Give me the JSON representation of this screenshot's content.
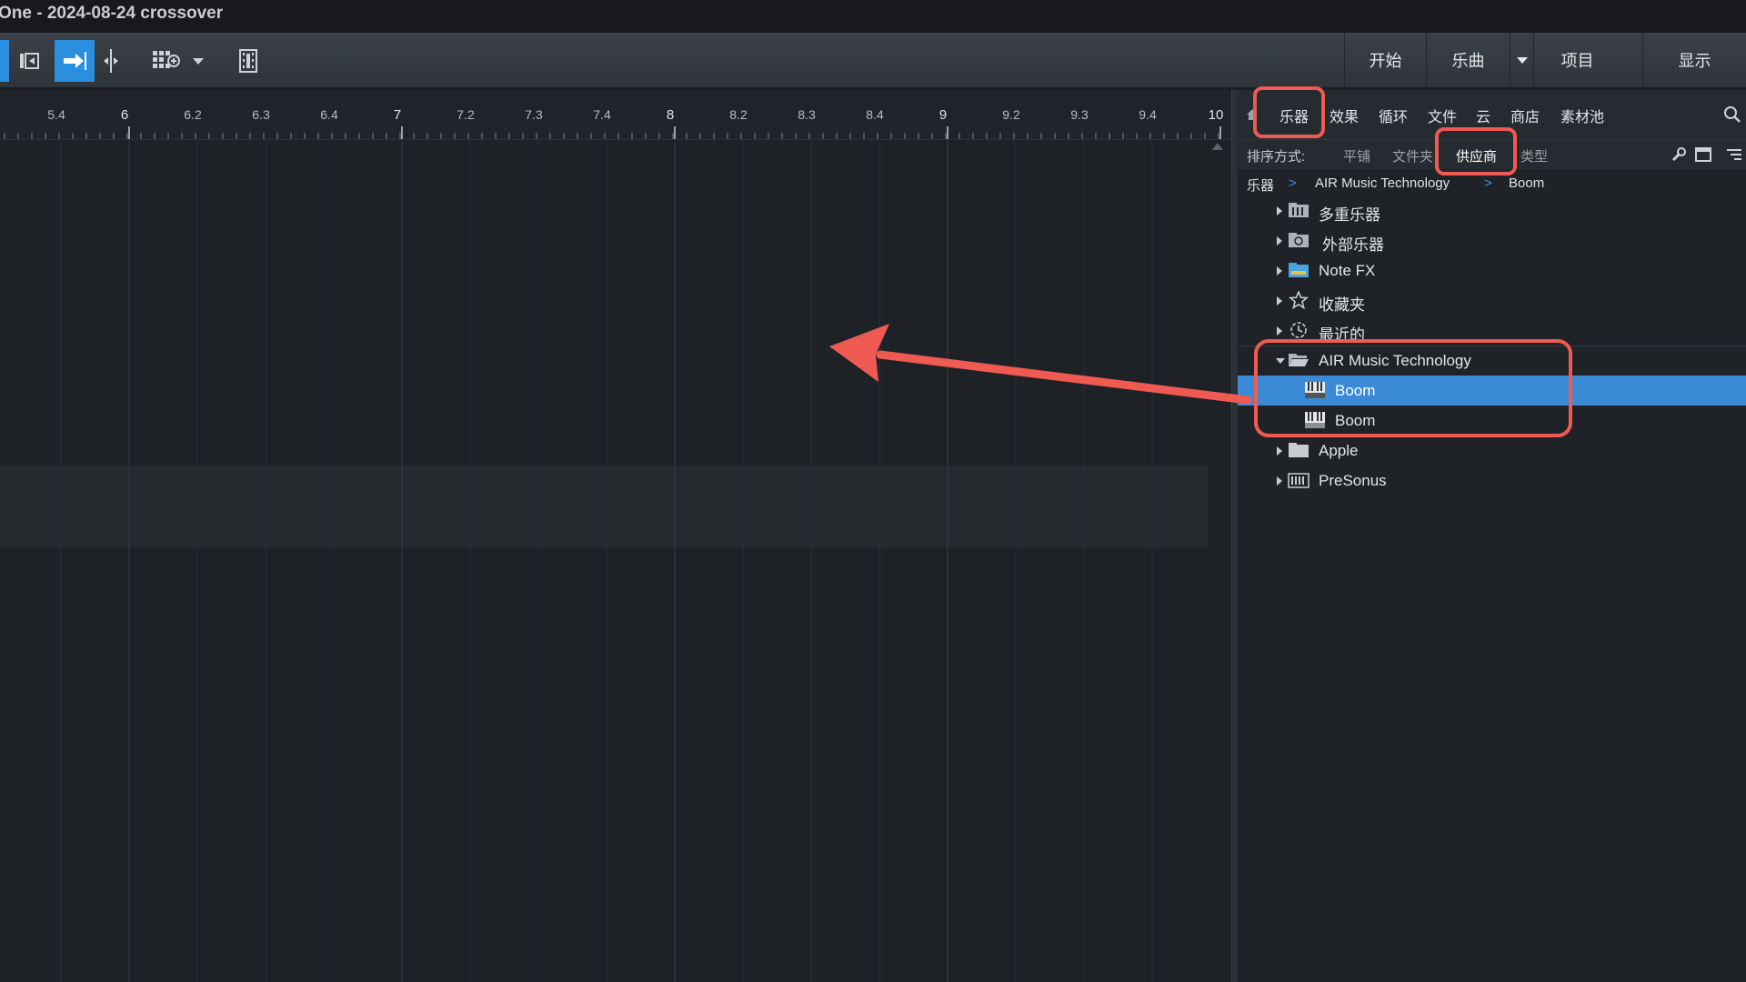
{
  "window": {
    "title": "One - 2024-08-24 crossover"
  },
  "toolbar": {
    "left_tools": [
      "track-zoom-icon",
      "follow-arrow-icon",
      "split-cursor-icon",
      "grid-add-icon",
      "dropdown-caret-icon",
      "film-strip-icon"
    ],
    "right_tabs": [
      {
        "label": "开始"
      },
      {
        "label": "乐曲"
      },
      {
        "label": "项目"
      },
      {
        "label": "显示"
      }
    ]
  },
  "ruler": {
    "labels": [
      "5.4",
      "6",
      "6.2",
      "6.3",
      "6.4",
      "7",
      "7.2",
      "7.3",
      "7.4",
      "8",
      "8.2",
      "8.3",
      "8.4",
      "9",
      "9.2",
      "9.3",
      "9.4",
      "10"
    ],
    "major": [
      "6",
      "7",
      "8",
      "9",
      "10"
    ]
  },
  "browser": {
    "tabs": [
      "乐器",
      "效果",
      "循环",
      "文件",
      "云",
      "商店",
      "素材池"
    ],
    "active_tab": "乐器",
    "sort": {
      "label": "排序方式:",
      "options": [
        "平铺",
        "文件夹",
        "供应商",
        "类型"
      ],
      "active": "供应商"
    },
    "breadcrumb": [
      "乐器",
      "AIR Music Technology",
      "Boom"
    ],
    "breadcrumb_sep": ">",
    "tree": [
      {
        "label": "多重乐器",
        "icon": "multi-instrument-folder-icon",
        "state": "closed"
      },
      {
        "label": "外部乐器",
        "icon": "external-instrument-folder-icon",
        "state": "closed"
      },
      {
        "label": "Note FX",
        "icon": "note-fx-folder-icon",
        "state": "closed"
      },
      {
        "label": "收藏夹",
        "icon": "star-icon",
        "state": "closed"
      },
      {
        "label": "最近的",
        "icon": "clock-icon",
        "state": "closed"
      },
      {
        "label": "AIR Music Technology",
        "icon": "open-folder-icon",
        "state": "open"
      },
      {
        "label": "Boom",
        "icon": "vst-plugin-icon",
        "state": "leaf",
        "selected": true
      },
      {
        "label": "Boom",
        "icon": "au-plugin-icon",
        "state": "leaf"
      },
      {
        "label": "Apple",
        "icon": "folder-icon",
        "state": "closed"
      },
      {
        "label": "PreSonus",
        "icon": "presonus-folder-icon",
        "state": "closed"
      }
    ]
  },
  "colors": {
    "accent": "#2b8fe0",
    "selection": "#3a8ad6",
    "annotation": "#ef5a52"
  }
}
